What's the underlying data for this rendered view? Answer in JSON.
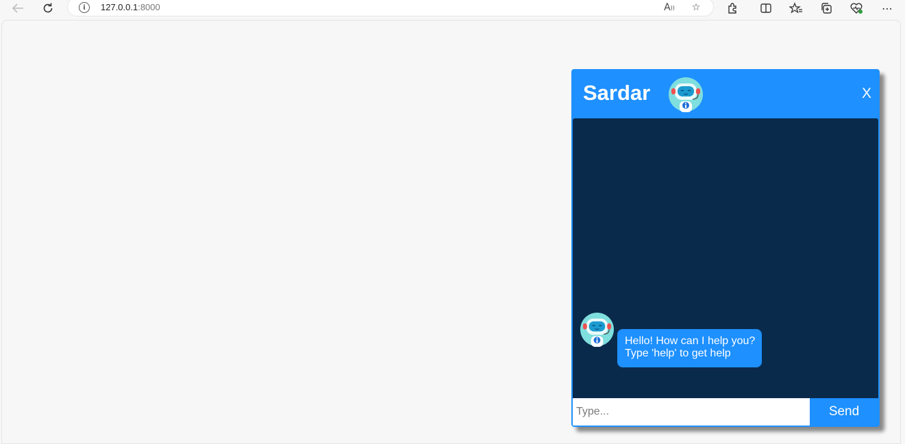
{
  "browser": {
    "url_host": "127.0.0.1",
    "url_port": ":8000",
    "icons": [
      "back-icon",
      "refresh-icon",
      "site-info-icon",
      "read-aloud-icon",
      "favorite-star-icon",
      "extensions-icon",
      "split-screen-icon",
      "favorites-icon",
      "collections-icon",
      "browser-essentials-icon",
      "more-icon"
    ]
  },
  "chat": {
    "title": "Sardar",
    "close_label": "X",
    "messages": [
      {
        "sender": "bot",
        "lines": [
          "Hello! How can I help you?",
          "Type 'help' to get help"
        ]
      }
    ],
    "input_placeholder": "Type...",
    "input_value": "",
    "send_label": "Send"
  },
  "colors": {
    "accent": "#1e90ff",
    "chat_body_bg": "#0a2a4b",
    "page_bg": "#f7f7f7"
  }
}
